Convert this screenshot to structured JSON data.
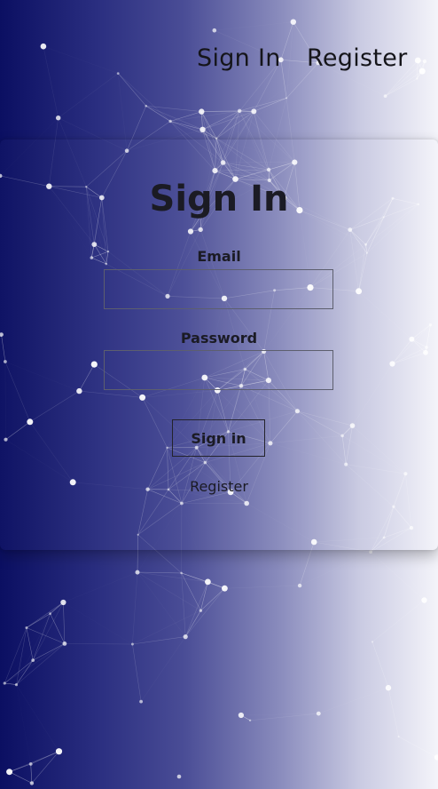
{
  "nav": {
    "signin_label": "Sign In",
    "register_label": "Register"
  },
  "form": {
    "title": "Sign In",
    "email_label": "Email",
    "email_value": "",
    "password_label": "Password",
    "password_value": "",
    "submit_label": "Sign in",
    "register_link": "Register"
  },
  "theme": {
    "gradient_start": "#0b0f62",
    "gradient_end": "#f4f4fa",
    "text_color": "#1b1b24"
  }
}
